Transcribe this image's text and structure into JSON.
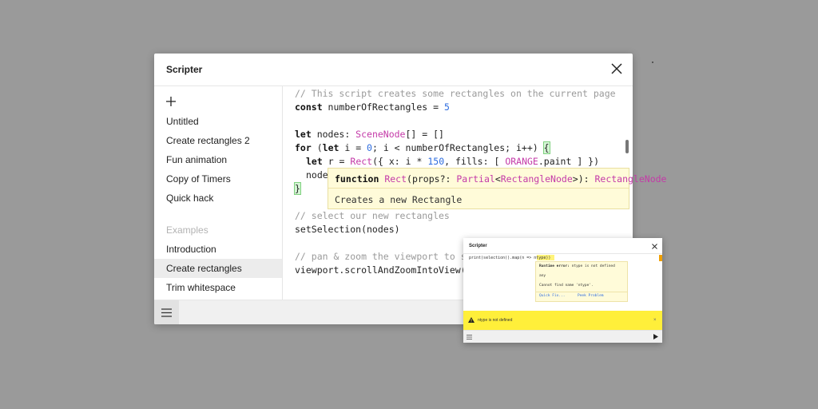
{
  "main": {
    "title": "Scripter",
    "sidebar": {
      "items": [
        "Untitled",
        "Create rectangles 2",
        "Fun animation",
        "Copy of Timers",
        "Quick hack"
      ],
      "section_label": "Examples",
      "examples": [
        "Introduction",
        "Create rectangles",
        "Trim whitespace"
      ],
      "selected": "Create rectangles"
    },
    "code": {
      "line1": "// This script creates some rectangles on the current page",
      "line2_kw": "const",
      "line2_rest": " numberOfRectangles = ",
      "line2_num": "5",
      "line4_kw": "let",
      "line4_a": " nodes: ",
      "line4_type": "SceneNode",
      "line4_b": "[] = []",
      "line5_kw": "for",
      "line5_a": " (",
      "line5_kw2": "let",
      "line5_b": " i = ",
      "line5_num": "0",
      "line5_c": "; i < numberOfRectangles; i++) ",
      "line5_brace": "{",
      "line6_kw": "let",
      "line6_a": " r = ",
      "line6_type": "Rect",
      "line6_b": "({ x: i * ",
      "line6_num": "150",
      "line6_c": ", fills: [ ",
      "line6_type2": "ORANGE",
      "line6_d": ".paint ] })",
      "line7": "node",
      "line8_brace": "}",
      "line9": "// select our new rectangles",
      "line10": "setSelection(nodes)",
      "line12": "// pan & zoom the viewport to sho",
      "line13": "viewport.scrollAndZoomIntoView(nod"
    },
    "tooltip": {
      "kw": "function",
      "name": "Rect",
      "a": "(props?: ",
      "type1": "Partial",
      "b": "<",
      "type2": "RectangleNode",
      "c": ">): ",
      "type3": "RectangleNode",
      "description": "Creates a new Rectangle"
    }
  },
  "small": {
    "title": "Scripter",
    "code": "print(selection().map(n => ntype))",
    "error_label": "Runtime error:",
    "error_msg": " ntype is not defined",
    "error_any": "any",
    "error_detail": "Cannot find name 'ntype'.",
    "quick_fix": "Quick Fix...",
    "peek_problem": "Peek Problem",
    "banner": "ntype is not defined",
    "banner_close": "×"
  },
  "colors": {
    "keyword": "#111111",
    "comment": "#9a9a9a",
    "number": "#2d6cdf",
    "type": "#c43aa8",
    "banner": "#ffef3a"
  },
  "icons": [
    "add-icon",
    "close-icon",
    "menu-icon",
    "warning-icon",
    "play-icon"
  ]
}
